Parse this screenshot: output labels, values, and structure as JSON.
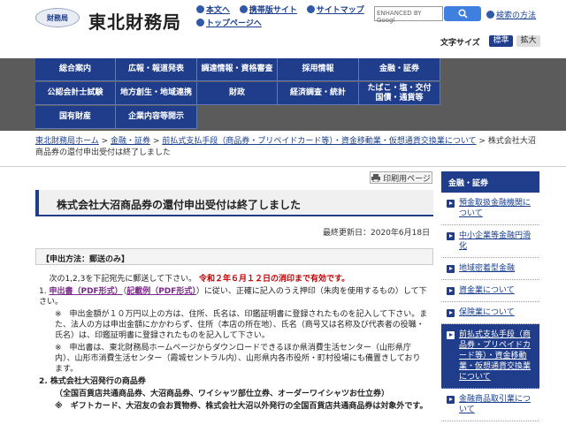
{
  "header": {
    "logo_text": "財務局",
    "site_name": "東北財務局",
    "links": [
      "本文へ",
      "携帯版サイト",
      "サイトマップ",
      "トップページへ"
    ],
    "search_placeholder": "ENHANCED BY Googl",
    "search_method": "検索の方法",
    "font_size_label": "文字サイズ",
    "font_standard": "標準",
    "font_large": "拡大"
  },
  "nav": {
    "row1": [
      "総合案内",
      "広報・報道発表",
      "調達情報・資格審査",
      "採用情報",
      "金融・証券"
    ],
    "row2": [
      "公認会計士試験",
      "地方創生・地域連携",
      "財政",
      "経済調査・統計",
      "たばこ・塩・交付国債・通貨等"
    ],
    "row3": [
      "国有財産",
      "企業内容等開示"
    ]
  },
  "breadcrumb": {
    "links": [
      "東北財務局ホーム",
      "金融・証券",
      "前払式支払手段（商品券・プリペイドカード等）・資金移動業・仮想通貨交換業について"
    ],
    "current": "株式会社大沼商品券の還付申出受付は終了しました"
  },
  "main": {
    "print_label": "印刷用ページ",
    "title": "株式会社大沼商品券の還付申出受付は終了しました",
    "updated": "最終更新日：2020年6月18日",
    "method": "【申出方法：郵送のみ】",
    "intro": "次の1,2,3を下記宛先に郵送して下さい。",
    "deadline": "令和２年６月１２日の消印まで有効です。",
    "item1_num": "1.",
    "item1_link1": "申出書（PDF形式）",
    "item1_link2": "記載例（PDF形式）",
    "item1_text_a": "（",
    "item1_text_b": "）に従い、正確に記入のうえ押印（朱肉を使用するもの）して下さい。",
    "note1": "※　申出金額が１０万円以上の方は、住所、氏名は、印鑑証明書に登録されたものを記入して下さい。また、法人の方は申出金額にかかわらず、住所（本店の所在地）、氏名（商号又は名称及び代表者の役職・氏名）は、印鑑証明書に登録されたものを記入して下さい。",
    "note2": "※　申出書は、東北財務局ホームページからダウンロードできるほか県消費生活センター（山形県庁内）、山形市消費生活センター（霞城セントラル内）、山形県内各市役所・町村役場にも備置きしております。",
    "item2_title": "2. 株式会社大沼発行の商品券",
    "item2_sub": "（全国百貨店共通商品券、大沼商品券、ワイシャツ部仕立券、オーダーワイシャツお仕立券）",
    "item2_note": "※　ギフトカード、大沼友の会お買物券、株式会社大沼以外発行の全国百貨店共通商品券は対象外です。"
  },
  "sidebar": {
    "heading": "金融・証券",
    "items": [
      "預金取扱金融機関について",
      "中小企業等金融円滑化",
      "地域密着型金融",
      "資金業について",
      "保険業について",
      "前払式支払手段（商品券・プリペイドカード等）・資金移動業・仮想通貨交換業について",
      "金融商品取引業について"
    ],
    "active_index": 5
  }
}
